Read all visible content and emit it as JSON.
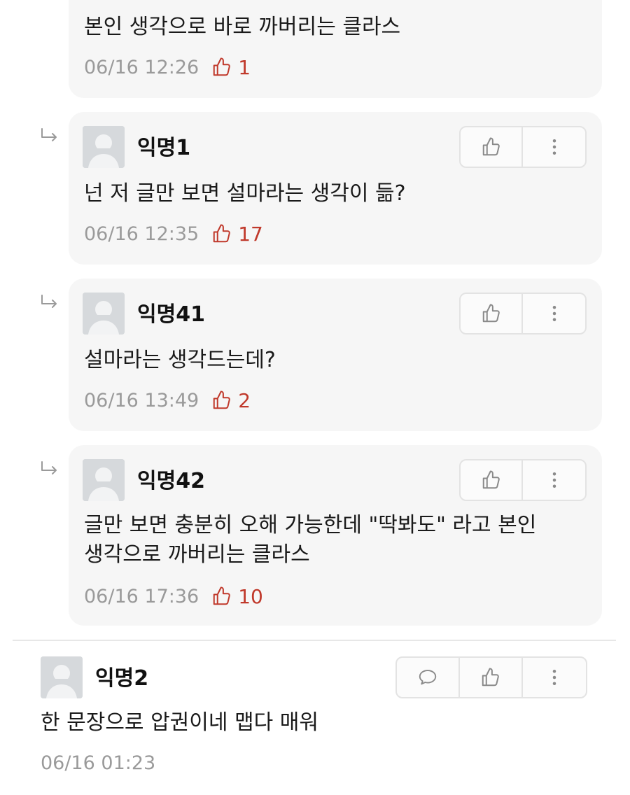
{
  "comments": [
    {
      "type": "reply-partial",
      "lines": [
        "본인 생각으로 바로 까버리는 클라스"
      ],
      "time": "06/16 12:26",
      "likes": "1"
    },
    {
      "type": "reply",
      "nick": "익명1",
      "lines": [
        "넌 저 글만 보면 설마라는 생각이 듦?"
      ],
      "time": "06/16 12:35",
      "likes": "17"
    },
    {
      "type": "reply",
      "nick": "익명41",
      "lines": [
        "설마라는 생각드는데?"
      ],
      "time": "06/16 13:49",
      "likes": "2"
    },
    {
      "type": "reply",
      "nick": "익명42",
      "lines": [
        "글만 보면 충분히 오해 가능한데 \"딱봐도\" 라고 본인",
        "생각으로 까버리는 클라스"
      ],
      "time": "06/16 17:36",
      "likes": "10"
    },
    {
      "type": "comment",
      "nick": "익명2",
      "lines": [
        "한 문장으로 압권이네 맵다 매워"
      ],
      "time": "06/16 01:23"
    }
  ],
  "icons": {
    "reply": "reply-arrow-icon",
    "like": "thumbs-up-icon",
    "more": "more-vertical-icon",
    "comment": "speech-bubble-icon",
    "avatar": "anonymous-avatar-icon"
  },
  "colors": {
    "card_bg": "#f6f6f6",
    "like_accent": "#c0392b",
    "meta_gray": "#9a9a9a",
    "avatar_bg": "#d6d9dc"
  }
}
